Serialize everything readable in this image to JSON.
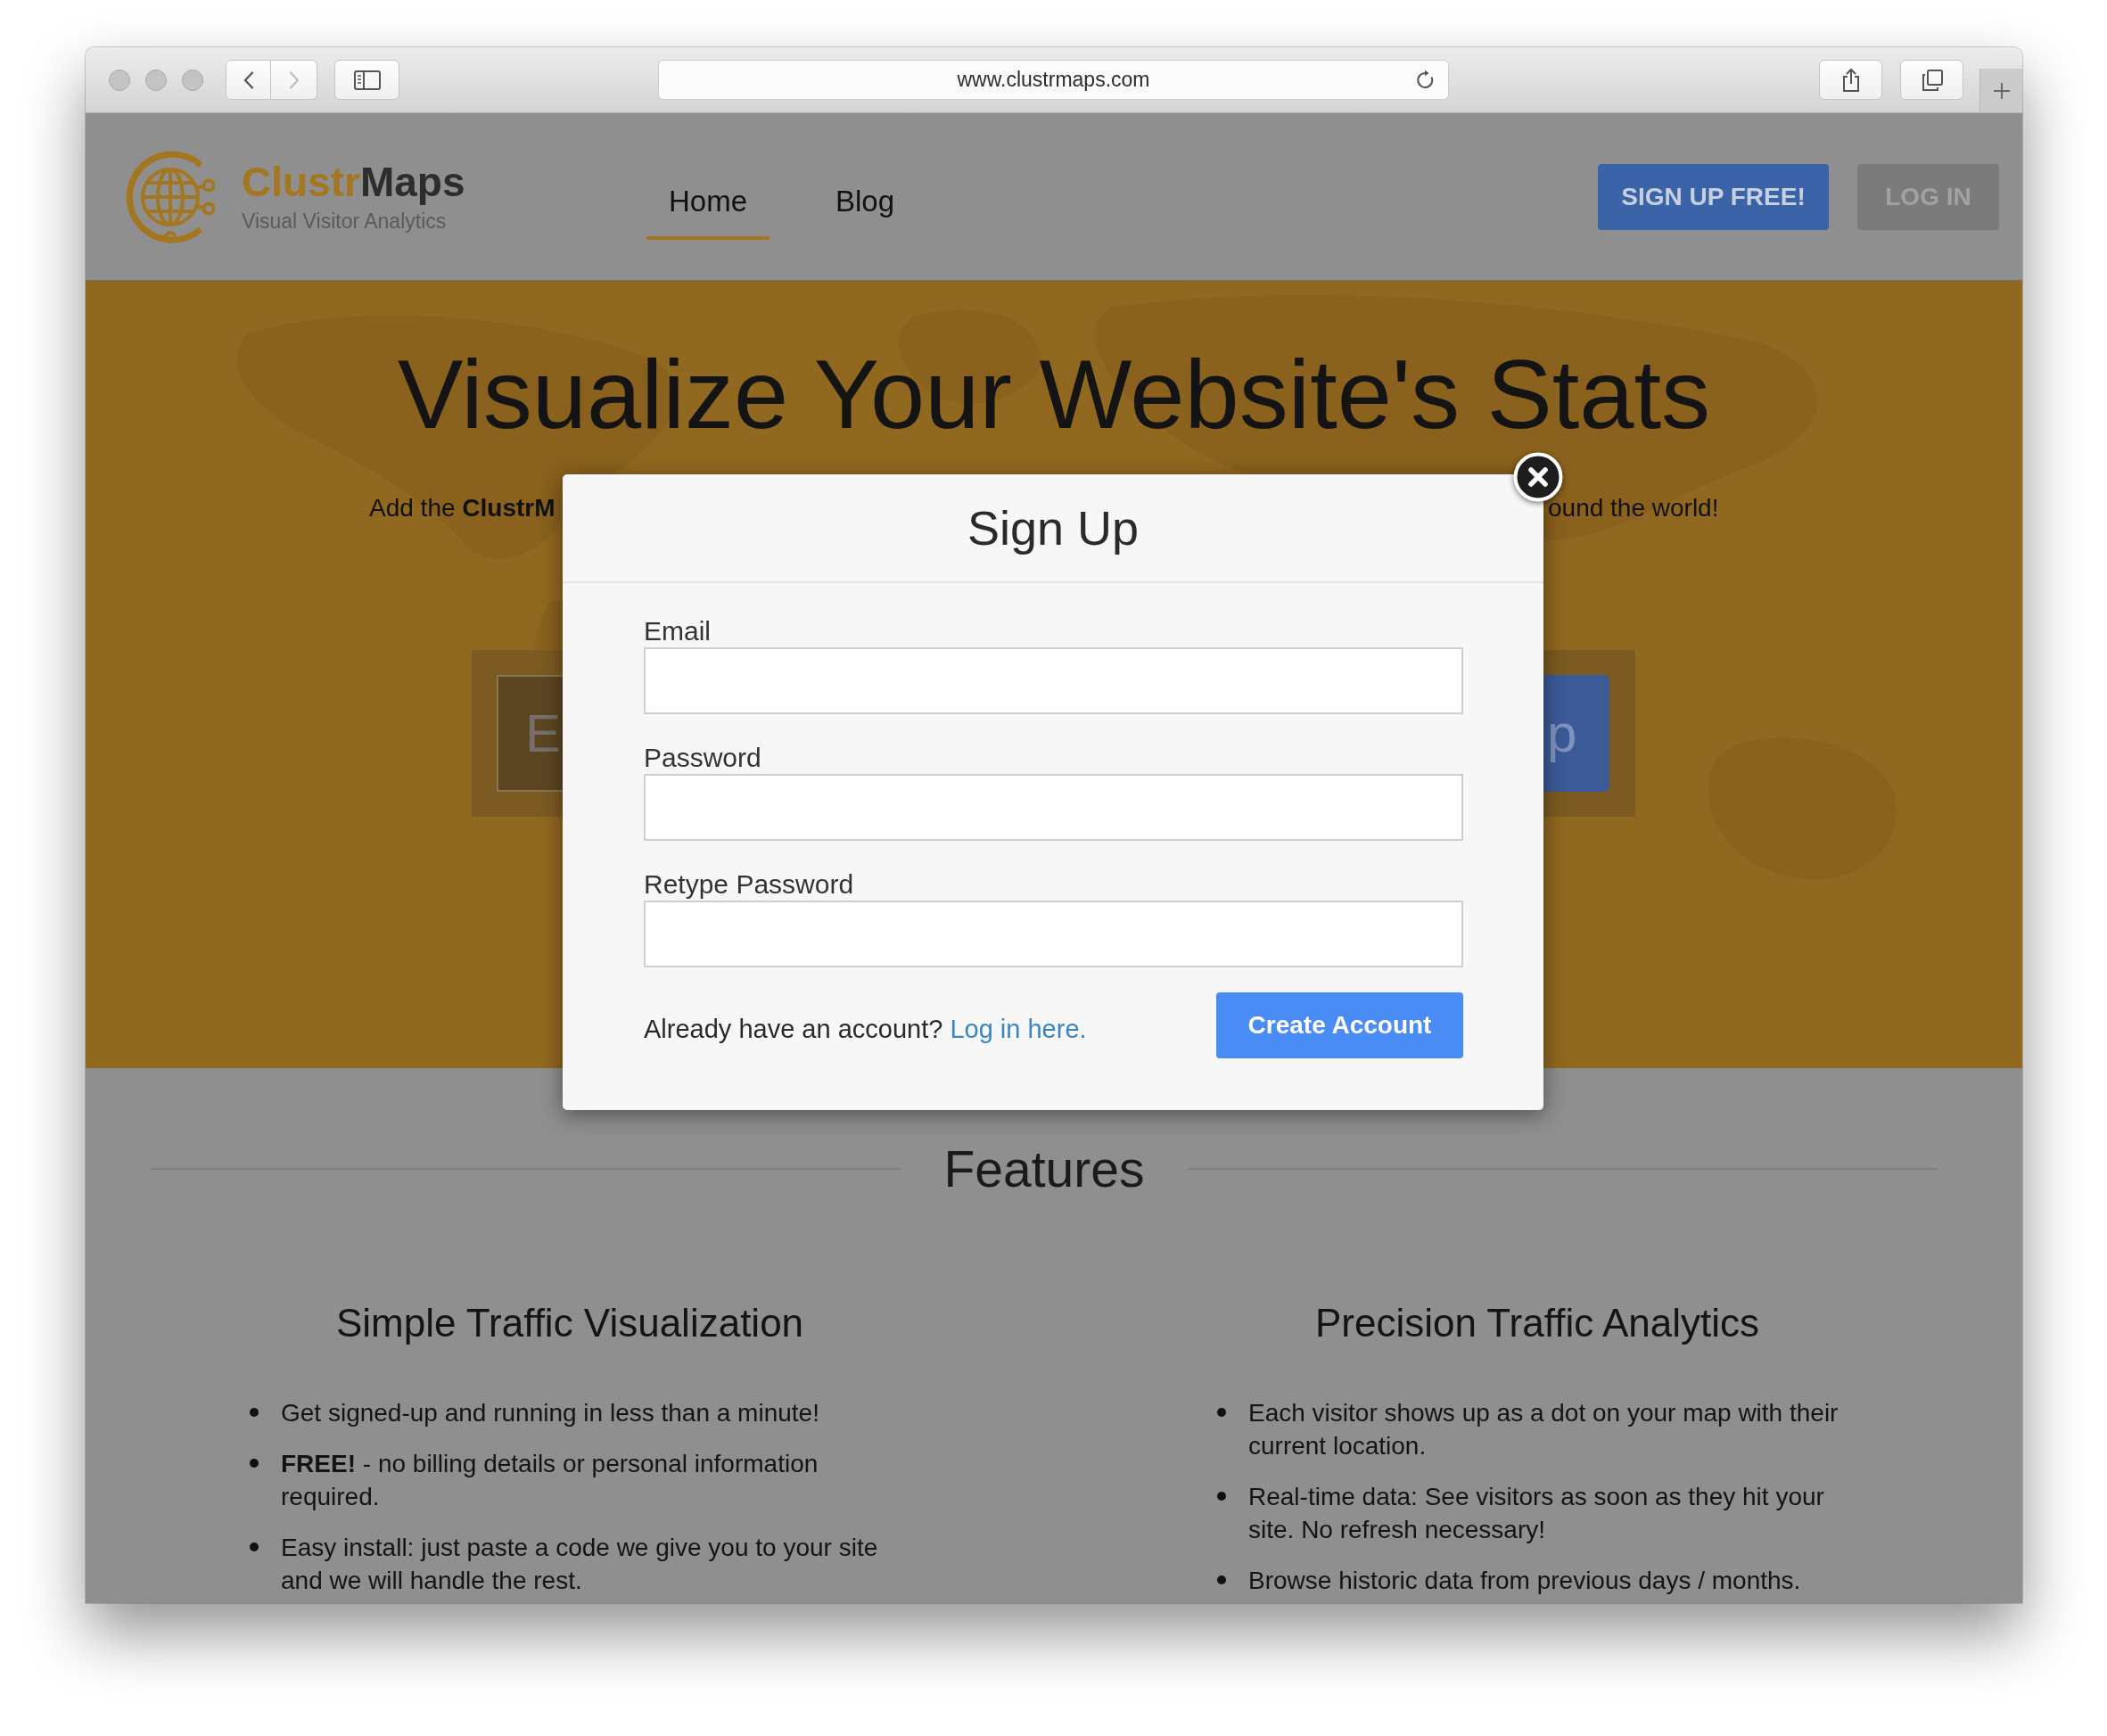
{
  "browser": {
    "back_button": {
      "disabled": false
    },
    "forward_button": {
      "disabled": true
    },
    "url": "www.clustrmaps.com"
  },
  "header": {
    "brand": {
      "name": [
        "Clustr",
        "Maps"
      ],
      "tagline": "Visual Visitor Analytics"
    },
    "nav": [
      {
        "label": "Home",
        "selected": true
      },
      {
        "label": "Blog",
        "selected": false
      }
    ],
    "buttons": [
      {
        "label": "SIGN UP FREE!",
        "kind": "primary"
      },
      {
        "label": "LOG IN",
        "kind": "secondary"
      }
    ]
  },
  "hero": {
    "title": "Visualize Your Website's Stats",
    "subtitle_left": "Add the **ClustrM**",
    "subtitle_right": "ound the world!",
    "email_field": {
      "placeholder": "E"
    },
    "submit_button": {
      "label": "p"
    }
  },
  "modal": {
    "title": "Sign Up",
    "fields": [
      {
        "label": "Email"
      },
      {
        "label": "Password"
      },
      {
        "label": "Retype Password"
      }
    ],
    "footer_text": "Already have an account?",
    "login_link": "Log in here.",
    "submit_button": "Create Account"
  },
  "features": {
    "title": "Features",
    "columns": [
      {
        "heading": "Simple Traffic Visualization",
        "items": [
          "Get signed-up and running in less than a minute!",
          "**FREE!** - no billing details or personal information required.",
          "Easy install: just paste a code we give you to your site and we will handle the rest."
        ]
      },
      {
        "heading": "Precision Traffic Analytics",
        "items": [
          "Each visitor shows up as a dot on your map with their current location.",
          "Real-time data: See visitors as soon as they hit your site. No refresh necessary!",
          "Browse historic data from previous days / months."
        ]
      }
    ]
  }
}
